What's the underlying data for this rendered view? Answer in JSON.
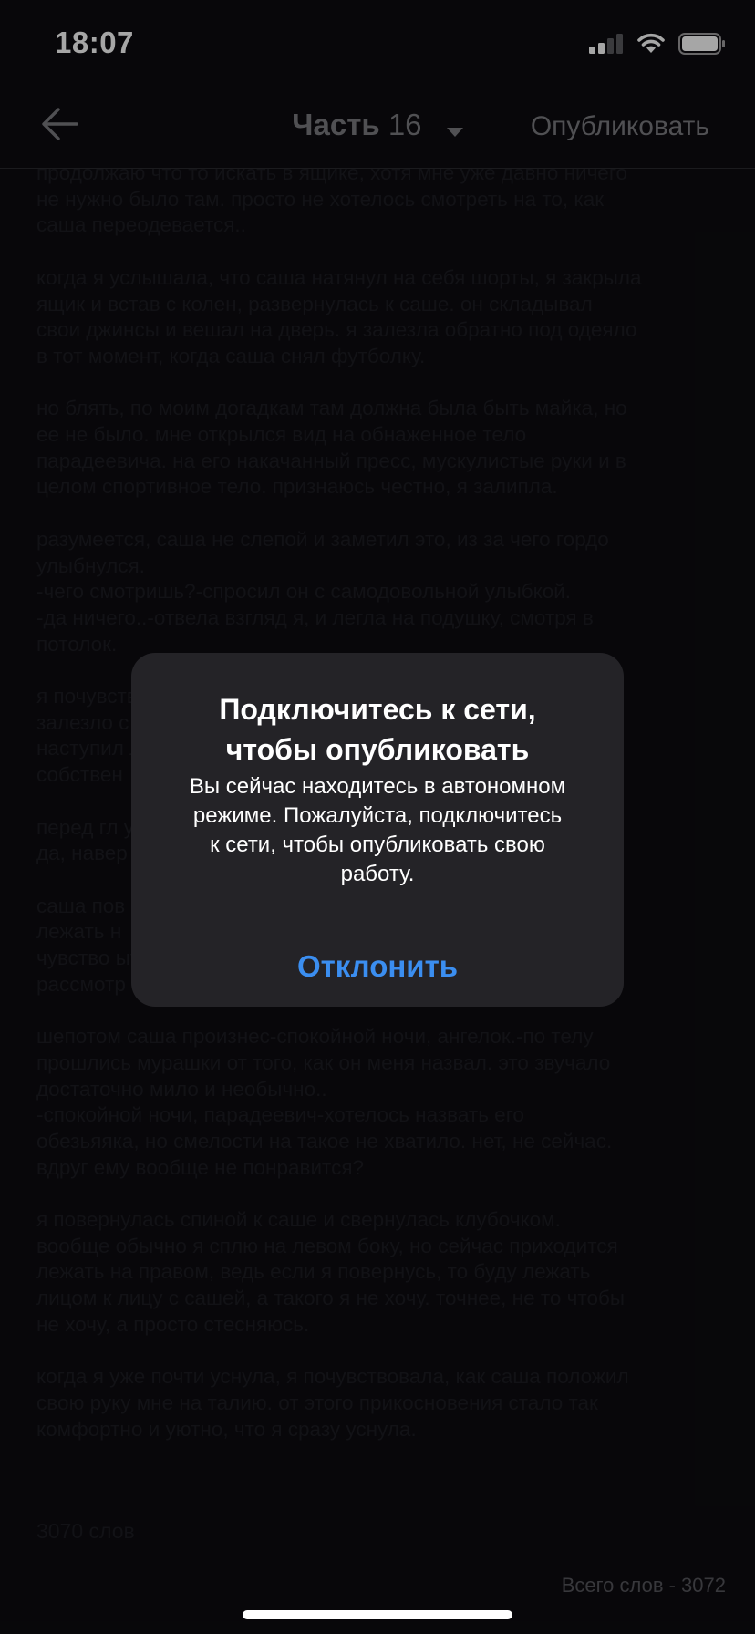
{
  "status_bar": {
    "time": "18:07"
  },
  "nav": {
    "part_label": "Часть",
    "part_number": "16",
    "publish_label": "Опубликовать"
  },
  "story": {
    "paragraphs": [
      "продолжаю что то искать в ящике, хотя мне уже давно ничего\nне нужно было там. просто не хотелось смотреть на то, как\nсаша переодевается..",
      "когда я услышала, что саша натянул на себя шорты, я закрыла\nящик и встав с колен, развернулась к саше. он складывал\nсвои джинсы и вешал на дверь. я залезла обратно под одеяло\nв тот момент, когда саша снял футболку.",
      "но блять, по моим догадкам там должна была быть майка, но\nее не было. мне открылся вид на обнаженное тело\nпарадеевича. на его накачанный пресс, мускулистые руки и в\nцелом спортивное тело. признаюсь честно, я залипла.",
      "разумеется, саша не слепой и заметил это, из за чего гордо\nулыбнулся.\n-чего смотришь?-спросил он с самодовольной улыбкой.\n-да ничего..-отвела взгляд я, и легла на подушку, смотря в\nпотолок.",
      "я почувствовала                                                       и что то\nзалезло                                                                с и\nнаступил                                                          лько мое\nсобствен",
      "перед гл                                                              утболки.\nда, навер",
      "саша пов                                                              олжала\nлежать н\nчувство                                                                 ытался\nрассмотр",
      "шепотом саша произнес-спокойной ночи, ангелок.-по телу\nпрошлись мурашки от того, как он меня назвал. это звучало\nдостаточно мило и необычно..\n-спокойной ночи, парадеевич-хотелось назвать его\nобезьяяка, но смелости на такое не хватило. нет, не сейчас.\nвдруг ему вообще не понравится?",
      "я повернулась спиной к саше и свернулась клубочком.\nвообще обычно я сплю на левом боку, но сейчас приходится\nлежать на правом, ведь если я повернусь, то буду лежать\nлицом к лицу с сашей, а такого я не хочу. точнее, не то чтобы\nне хочу, а просто стесняюсь.",
      "когда я уже почти уснула, я почувствовала, как саша положил\nсвою руку мне на талию. от этого прикосновения стало так\nкомфортно и уютно, что я сразу уснула."
    ],
    "part_word_count": "3070 слов",
    "total_word_count": "Всего слов - 3072"
  },
  "alert": {
    "title": "Подключитесь к сети,\nчтобы опубликовать",
    "message": "Вы сейчас находитесь в автономном\nрежиме. Пожалуйста, подключитесь\nк сети, чтобы опубликовать свою\nработу.",
    "dismiss_label": "Отклонить"
  },
  "colors": {
    "background": "#0d0c10",
    "nav_text": "#7b7b80",
    "story_text": "#1c1c22",
    "alert_background": "#242327",
    "accent_blue": "#3b8ef0"
  },
  "icons": [
    "cellular-signal-icon",
    "wifi-icon",
    "battery-icon",
    "back-arrow-icon",
    "caret-down-icon"
  ]
}
